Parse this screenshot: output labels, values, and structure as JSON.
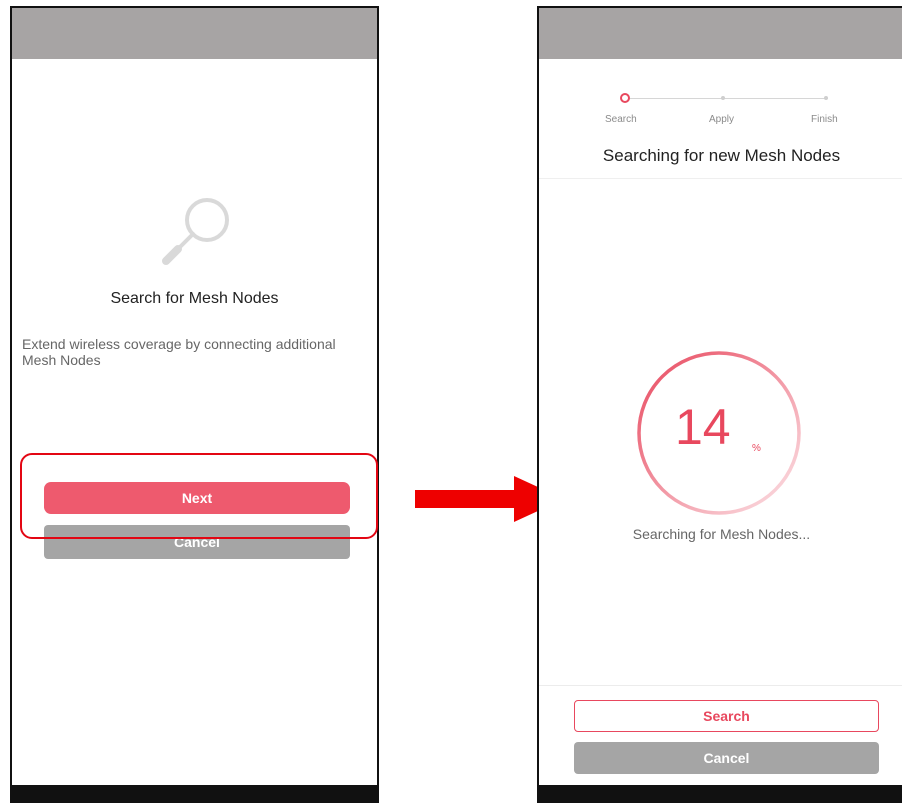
{
  "left_screen": {
    "title": "Search for Mesh Nodes",
    "description": "Extend wireless coverage by connecting additional Mesh Nodes",
    "next_label": "Next",
    "cancel_label": "Cancel",
    "illustration_icon": "magnifier-icon"
  },
  "right_screen": {
    "steps": [
      "Search",
      "Apply",
      "Finish"
    ],
    "active_step": 0,
    "title": "Searching for new Mesh Nodes",
    "progress_value": "14",
    "progress_unit": "%",
    "status_text": "Searching for Mesh Nodes...",
    "search_label": "Search",
    "cancel_label": "Cancel"
  },
  "colors": {
    "accent": "#e8485e",
    "status_bar": "#a7a4a4",
    "secondary_button": "#a5a5a5",
    "annotation_red": "#e30613"
  }
}
